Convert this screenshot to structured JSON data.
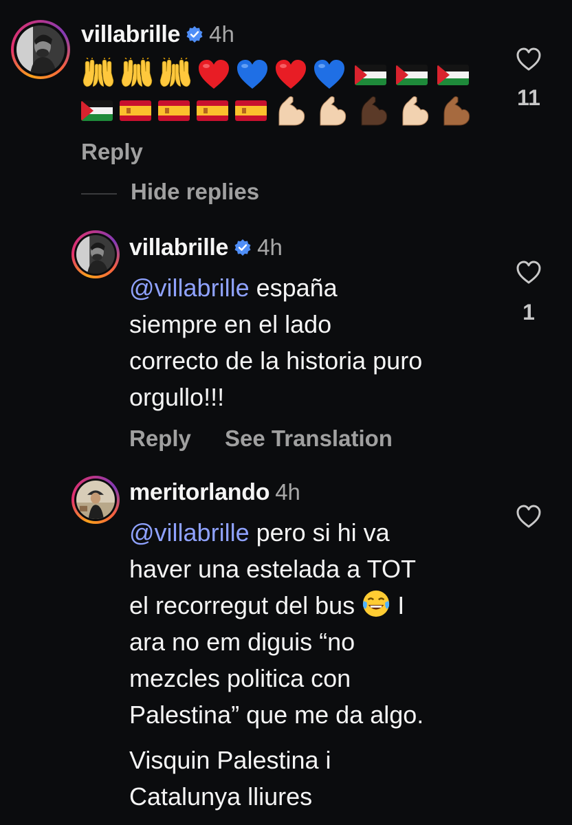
{
  "thread": {
    "top_comment": {
      "username": "villabrille",
      "verified": true,
      "time": "4h",
      "emoji_line_1": [
        "raising-hands",
        "raising-hands",
        "raising-hands",
        "red-heart",
        "blue-heart",
        "red-heart",
        "blue-heart",
        "palestine-flag",
        "palestine-flag",
        "palestine-flag"
      ],
      "emoji_line_2": [
        "palestine-flag",
        "spain-flag",
        "spain-flag",
        "spain-flag",
        "spain-flag",
        "flexed-biceps-light",
        "flexed-biceps-light",
        "flexed-biceps-dark",
        "flexed-biceps-light",
        "flexed-biceps-medium"
      ],
      "reply_label": "Reply",
      "likes": "11"
    },
    "hide_replies_label": "Hide replies",
    "replies": [
      {
        "username": "villabrille",
        "verified": true,
        "time": "4h",
        "mention": "@villabrille",
        "text_line1": " españa",
        "text_line2": "siempre en el lado",
        "text_line3": "correcto de la historia puro",
        "text_line4": "orgullo!!!",
        "reply_label": "Reply",
        "translate_label": "See Translation",
        "likes": "1"
      },
      {
        "username": "meritorlando",
        "verified": false,
        "time": "4h",
        "mention": "@villabrille",
        "text_line1": " pero si hi va",
        "text_line2": "haver una estelada a TOT",
        "text_line3a": "el recorregut del bus ",
        "text_line3_emoji": "face-with-tears-of-joy",
        "text_line3b": " I",
        "text_line4": "ara no em diguis “no",
        "text_line5": "mezcles politica con",
        "text_line6": "Palestina” que me da algo.",
        "text_line7": "Visquin Palestina i",
        "text_line8": "Catalunya lliures"
      }
    ]
  },
  "colors": {
    "background": "#0b0c0e",
    "mention": "#8fa2ff",
    "verified": "#4f8ef7",
    "muted": "#a0a0a0"
  }
}
